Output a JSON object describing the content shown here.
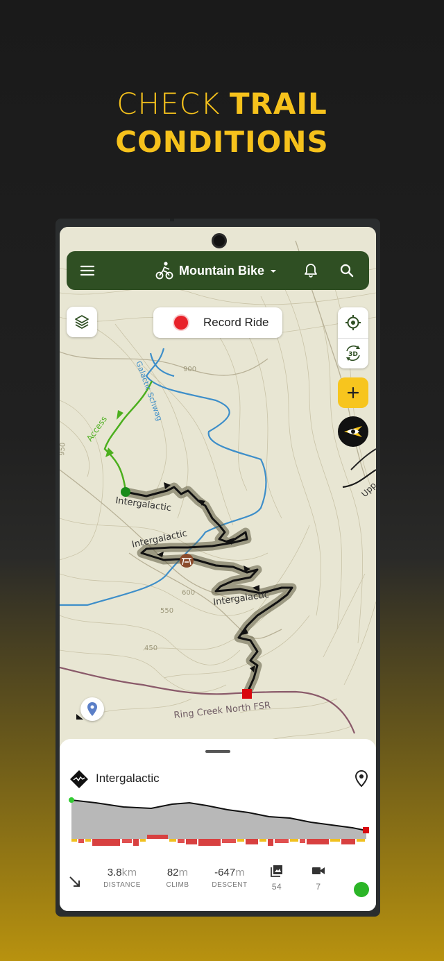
{
  "headline": {
    "line1_light": "CHECK",
    "line1_bold": "TRAIL",
    "line2_bold": "CONDITIONS"
  },
  "appbar": {
    "activity": "Mountain Bike",
    "activity_icon": "cyclist-icon"
  },
  "map": {
    "record_button": "Record Ride",
    "three_d_label": "3D",
    "contour_labels": [
      "900",
      "950",
      "600",
      "550",
      "450"
    ],
    "trail_labels": [
      "Access",
      "Intergalactic",
      "Intergalactic",
      "Intergalactic",
      "Galactic Schwag",
      "Upp"
    ],
    "road_label": "Ring Creek North FSR",
    "colors": {
      "trail_highlight": "#1a1a1a",
      "access": "#4caf1e",
      "stream": "#3d8ec9",
      "road": "#8a5a6a",
      "end_marker": "#d9090f"
    }
  },
  "sheet": {
    "trail_name": "Intergalactic",
    "stats": [
      {
        "value": "3.8",
        "unit": "km",
        "label": "DISTANCE"
      },
      {
        "value": "82",
        "unit": "m",
        "label": "CLIMB"
      },
      {
        "value": "-647",
        "unit": "m",
        "label": "DESCENT"
      }
    ],
    "photos_count": "54",
    "videos_count": "7",
    "status_color": "#2bb527"
  }
}
